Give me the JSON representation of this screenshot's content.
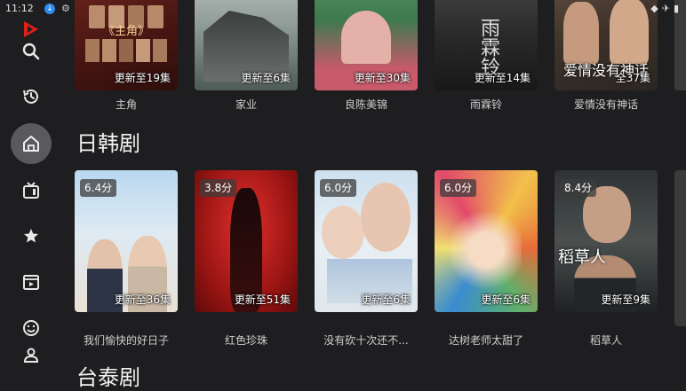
{
  "status_bar": {
    "time": "11:12"
  },
  "sidebar": {
    "items": [
      {
        "name": "search"
      },
      {
        "name": "history"
      },
      {
        "name": "home"
      },
      {
        "name": "tv"
      },
      {
        "name": "favorites"
      },
      {
        "name": "movies"
      },
      {
        "name": "emoji"
      },
      {
        "name": "user"
      }
    ]
  },
  "top_row": [
    {
      "update": "更新至19集",
      "title": "主角",
      "poster_text": "《主角》"
    },
    {
      "update": "更新至6集",
      "title": "家业"
    },
    {
      "update": "更新至30集",
      "title": "良陈美锦"
    },
    {
      "update": "更新至14集",
      "title": "雨霖铃",
      "poster_text": "雨霖铃"
    },
    {
      "update": "全37集",
      "title": "爱情没有神话",
      "poster_text": "爱情没有神话"
    }
  ],
  "section_kr": {
    "title": "日韩剧",
    "items": [
      {
        "score": "6.4分",
        "update": "更新至36集",
        "title": "我们愉快的好日子"
      },
      {
        "score": "3.8分",
        "update": "更新至51集",
        "title": "红色珍珠"
      },
      {
        "score": "6.0分",
        "update": "更新至6集",
        "title": "没有砍十次还不..."
      },
      {
        "score": "6.0分",
        "update": "更新至6集",
        "title": "达树老师太甜了"
      },
      {
        "score": "8.4分",
        "update": "更新至9集",
        "title": "稻草人",
        "poster_text": "稻草人"
      }
    ]
  },
  "section_tw": {
    "title": "台泰剧"
  }
}
